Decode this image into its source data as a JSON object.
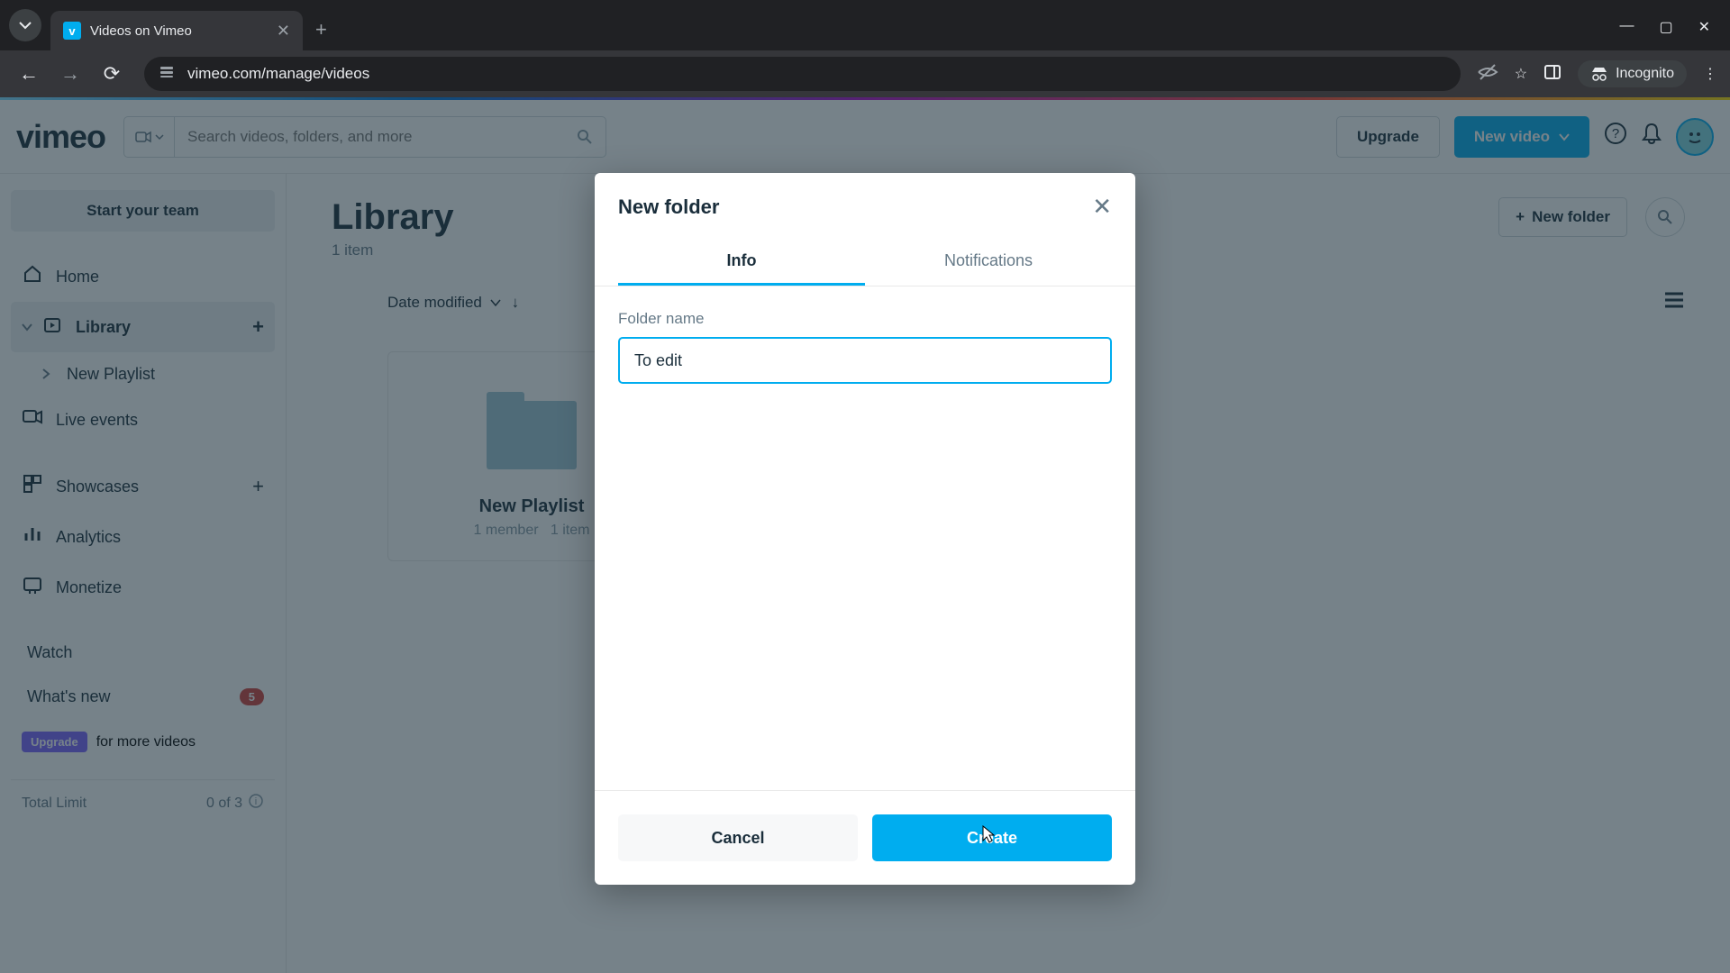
{
  "browser": {
    "tab_title": "Videos on Vimeo",
    "url": "vimeo.com/manage/videos",
    "incognito_label": "Incognito"
  },
  "header": {
    "search_placeholder": "Search videos, folders, and more",
    "upgrade_label": "Upgrade",
    "new_video_label": "New video"
  },
  "sidebar": {
    "start_team": "Start your team",
    "home": "Home",
    "library": "Library",
    "new_playlist": "New Playlist",
    "live_events": "Live events",
    "showcases": "Showcases",
    "analytics": "Analytics",
    "monetize": "Monetize",
    "watch": "Watch",
    "whats_new": "What's new",
    "whats_new_count": "5",
    "upgrade_tag": "Upgrade",
    "upgrade_text": "for more videos",
    "limit_label": "Total Limit",
    "limit_value": "0 of 3"
  },
  "content": {
    "title": "Library",
    "item_count": "1 item",
    "new_folder_btn": "New folder",
    "sort_label": "Date modified",
    "folder": {
      "name": "New Playlist",
      "members": "1 member",
      "items_partial": "1 item"
    }
  },
  "modal": {
    "title": "New folder",
    "tab_info": "Info",
    "tab_notifications": "Notifications",
    "field_label": "Folder name",
    "field_value": "To edit",
    "cancel": "Cancel",
    "create": "Create"
  }
}
